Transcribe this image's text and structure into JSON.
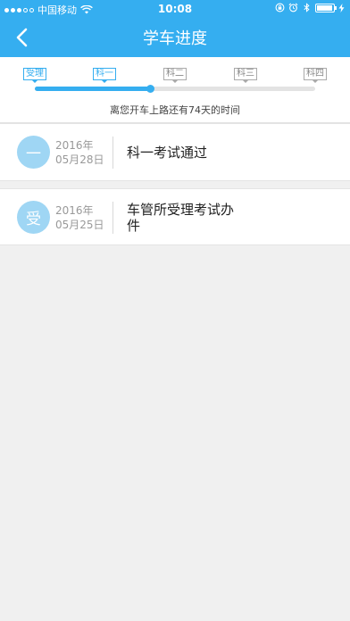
{
  "status_bar": {
    "carrier": "中国移动",
    "time": "10:08"
  },
  "nav": {
    "title": "学车进度"
  },
  "progress": {
    "stages": [
      {
        "label": "受理",
        "done": true
      },
      {
        "label": "科一",
        "done": true
      },
      {
        "label": "科二",
        "done": false
      },
      {
        "label": "科三",
        "done": false
      },
      {
        "label": "科四",
        "done": false
      }
    ],
    "fraction": 0.41,
    "remaining_text": "离您开车上路还有74天的时间"
  },
  "timeline": [
    {
      "badge": "一",
      "year": "2016年",
      "date": "05月28日",
      "event": "科一考试通过"
    },
    {
      "badge": "受",
      "year": "2016年",
      "date": "05月25日",
      "event": "车管所受理考试办件"
    }
  ],
  "colors": {
    "primary": "#35aef0",
    "badge": "#9fd6f4",
    "background": "#f0f0f0"
  },
  "icons": {
    "back": "chevron-left-icon",
    "wifi": "wifi-icon",
    "lock": "rotation-lock-icon",
    "alarm": "alarm-icon",
    "bluetooth": "bluetooth-icon",
    "battery": "battery-icon",
    "charging": "bolt-icon"
  }
}
